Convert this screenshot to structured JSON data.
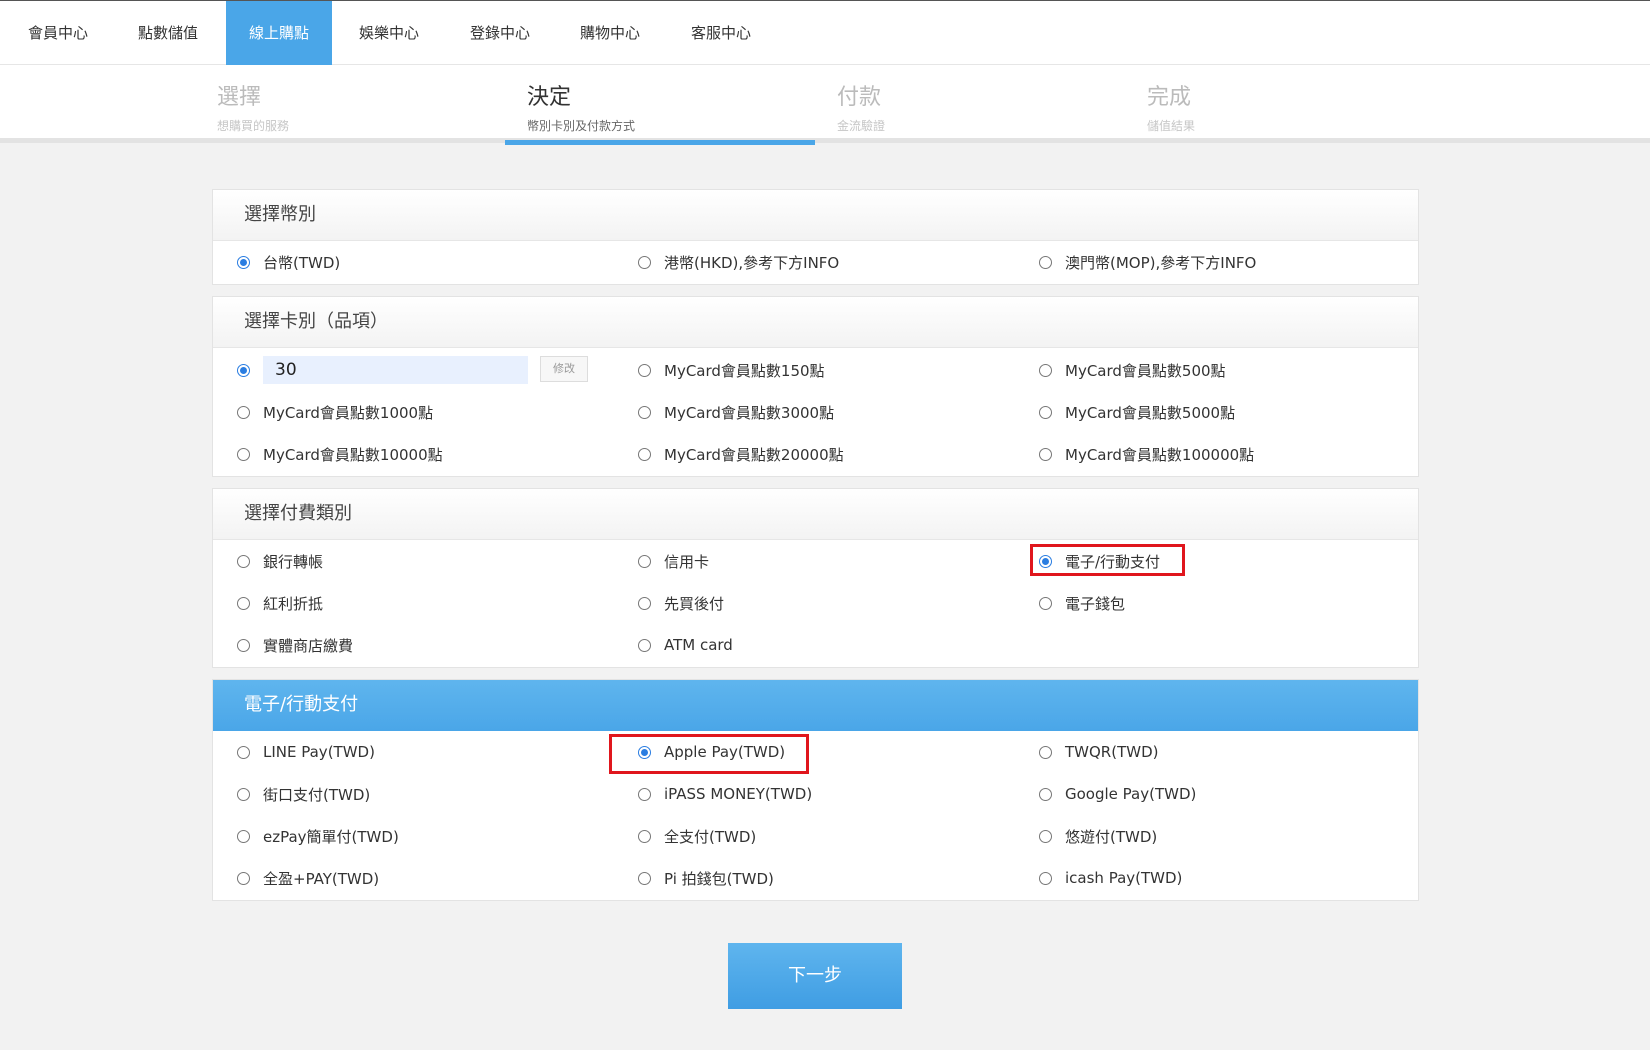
{
  "nav": {
    "items": [
      {
        "label": "會員中心",
        "active": false
      },
      {
        "label": "點數儲值",
        "active": false
      },
      {
        "label": "線上購點",
        "active": true
      },
      {
        "label": "娛樂中心",
        "active": false
      },
      {
        "label": "登錄中心",
        "active": false
      },
      {
        "label": "購物中心",
        "active": false
      },
      {
        "label": "客服中心",
        "active": false
      }
    ]
  },
  "steps": [
    {
      "title": "選擇",
      "sub": "想購買的服務",
      "active": false
    },
    {
      "title": "決定",
      "sub": "幣別卡別及付款方式",
      "active": true
    },
    {
      "title": "付款",
      "sub": "金流驗證",
      "active": false
    },
    {
      "title": "完成",
      "sub": "儲值結果",
      "active": false
    }
  ],
  "currency": {
    "title": "選擇幣別",
    "options": [
      {
        "label": "台幣(TWD)",
        "checked": true
      },
      {
        "label": "港幣(HKD),參考下方INFO",
        "checked": false
      },
      {
        "label": "澳門幣(MOP),參考下方INFO",
        "checked": false
      }
    ]
  },
  "card": {
    "title": "選擇卡別（品項）",
    "custom_value": "30",
    "edit_label": "修改",
    "options": [
      {
        "label": "MyCard會員點數150點",
        "checked": false
      },
      {
        "label": "MyCard會員點數500點",
        "checked": false
      },
      {
        "label": "MyCard會員點數1000點",
        "checked": false
      },
      {
        "label": "MyCard會員點數3000點",
        "checked": false
      },
      {
        "label": "MyCard會員點數5000點",
        "checked": false
      },
      {
        "label": "MyCard會員點數10000點",
        "checked": false
      },
      {
        "label": "MyCard會員點數20000點",
        "checked": false
      },
      {
        "label": "MyCard會員點數100000點",
        "checked": false
      }
    ]
  },
  "paytype": {
    "title": "選擇付費類別",
    "options": [
      {
        "label": "銀行轉帳",
        "checked": false
      },
      {
        "label": "信用卡",
        "checked": false
      },
      {
        "label": "電子/行動支付",
        "checked": true
      },
      {
        "label": "紅利折抵",
        "checked": false
      },
      {
        "label": "先買後付",
        "checked": false
      },
      {
        "label": "電子錢包",
        "checked": false
      },
      {
        "label": "實體商店繳費",
        "checked": false
      },
      {
        "label": "ATM card",
        "checked": false
      }
    ]
  },
  "epay": {
    "title": "電子/行動支付",
    "options": [
      {
        "label": "LINE Pay(TWD)",
        "checked": false
      },
      {
        "label": "Apple Pay(TWD)",
        "checked": true
      },
      {
        "label": "TWQR(TWD)",
        "checked": false
      },
      {
        "label": "街口支付(TWD)",
        "checked": false
      },
      {
        "label": "iPASS MONEY(TWD)",
        "checked": false
      },
      {
        "label": "Google Pay(TWD)",
        "checked": false
      },
      {
        "label": "ezPay簡單付(TWD)",
        "checked": false
      },
      {
        "label": "全支付(TWD)",
        "checked": false
      },
      {
        "label": "悠遊付(TWD)",
        "checked": false
      },
      {
        "label": "全盈+PAY(TWD)",
        "checked": false
      },
      {
        "label": "Pi 拍錢包(TWD)",
        "checked": false
      },
      {
        "label": "icash Pay(TWD)",
        "checked": false
      }
    ]
  },
  "next_label": "下一步",
  "colors": {
    "accent": "#4aa6e8",
    "highlight": "#e0161d",
    "radio": "#2a7de1"
  }
}
